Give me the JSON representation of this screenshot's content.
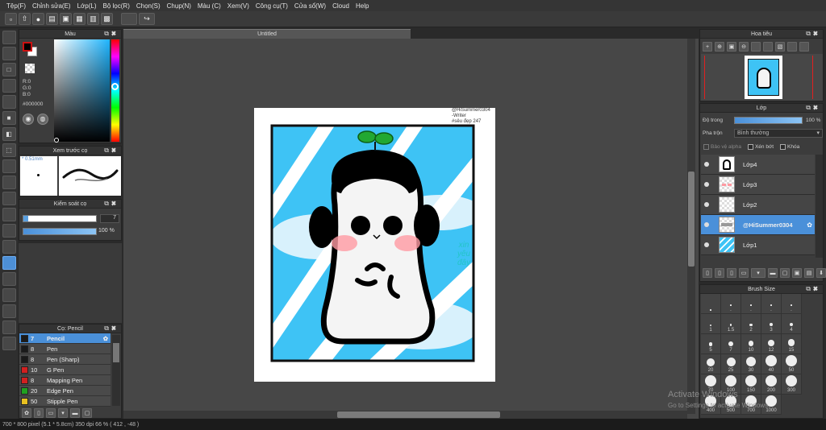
{
  "menu": [
    "Tệp(F)",
    "Chỉnh sửa(E)",
    "Lớp(L)",
    "Bộ lọc(R)",
    "Chọn(S)",
    "Chụp(N)",
    "Màu (C)",
    "Xem(V)",
    "Công cụ(T)",
    "Cửa sổ(W)",
    "Cloud",
    "Help"
  ],
  "document": {
    "title": "Untitled"
  },
  "color_panel": {
    "title": "Màu",
    "r": "R:0",
    "g": "G:0",
    "b": "B:0",
    "hex": "#000000",
    "fg_color": "#000000",
    "bg_color": "#ffffff",
    "accent": "#cc1111"
  },
  "preview_panel": {
    "title": "Xem trước cọ",
    "size": "0.51mm"
  },
  "control_panel": {
    "title": "Kiểm soát cọ",
    "size_value": "7",
    "opacity_value": "100 %",
    "opacity": 1.0,
    "size_fraction": 0.07
  },
  "brush_panel": {
    "title": "Cọ: Pencil",
    "brushes": [
      {
        "size": "7",
        "name": "Pencil",
        "color": "#1a1a1a",
        "selected": true
      },
      {
        "size": "8",
        "name": "Pen",
        "color": "#1a1a1a",
        "selected": false
      },
      {
        "size": "8",
        "name": "Pen (Sharp)",
        "color": "#1a1a1a",
        "selected": false
      },
      {
        "size": "10",
        "name": "G Pen",
        "color": "#d12020",
        "selected": false
      },
      {
        "size": "8",
        "name": "Mapping Pen",
        "color": "#d12020",
        "selected": false
      },
      {
        "size": "20",
        "name": "Edge Pen",
        "color": "#20a020",
        "selected": false
      },
      {
        "size": "50",
        "name": "Stipple Pen",
        "color": "#e8c020",
        "selected": false
      }
    ]
  },
  "artwork": {
    "watermark_lines": [
      "@HiSummer0304",
      "-Writer",
      "#sêu đẹp 247"
    ],
    "sign_lines": [
      "xin",
      "yêu",
      "đây"
    ],
    "sky_color": "#3ec3f5",
    "sprout_color": "#22a832"
  },
  "navigator": {
    "title": "Hoa tiêu"
  },
  "layer_panel": {
    "title": "Lớp",
    "opacity_label": "Độ trong",
    "opacity_value": "100 %",
    "opacity": 1.0,
    "blend_label": "Pha trộn",
    "blend_value": "Bình thường",
    "protect_alpha": "Bảo vệ alpha",
    "clipping": "Xén bớt",
    "lock": "Khóa",
    "layers": [
      {
        "name": "Lớp4",
        "selected": false,
        "thumb": "bear"
      },
      {
        "name": "Lớp3",
        "selected": false,
        "thumb": "cheeks"
      },
      {
        "name": "Lớp2",
        "selected": false,
        "thumb": "empty"
      },
      {
        "name": "@HiSummer0304",
        "selected": true,
        "thumb": "text"
      },
      {
        "name": "Lớp1",
        "selected": false,
        "thumb": "sky"
      }
    ]
  },
  "brush_size_panel": {
    "title": "Brush Size",
    "sizes": [
      "",
      ".",
      ".",
      ".",
      ".",
      "1",
      "1.5",
      "2",
      "3",
      "4",
      "5",
      "7",
      "10",
      "12",
      "15",
      "20",
      "25",
      "30",
      "40",
      "50",
      "70",
      "100",
      "150",
      "200",
      "300",
      "400",
      "500",
      "700",
      "1000"
    ]
  },
  "watermark": {
    "line1": "Activate Windows",
    "line2": "Go to Settings to activate Windows."
  },
  "status": {
    "text": "700 * 800 pixel   (5.1 * 5.8cm)   350 dpi   66 %   ( 412 , -48 )"
  }
}
